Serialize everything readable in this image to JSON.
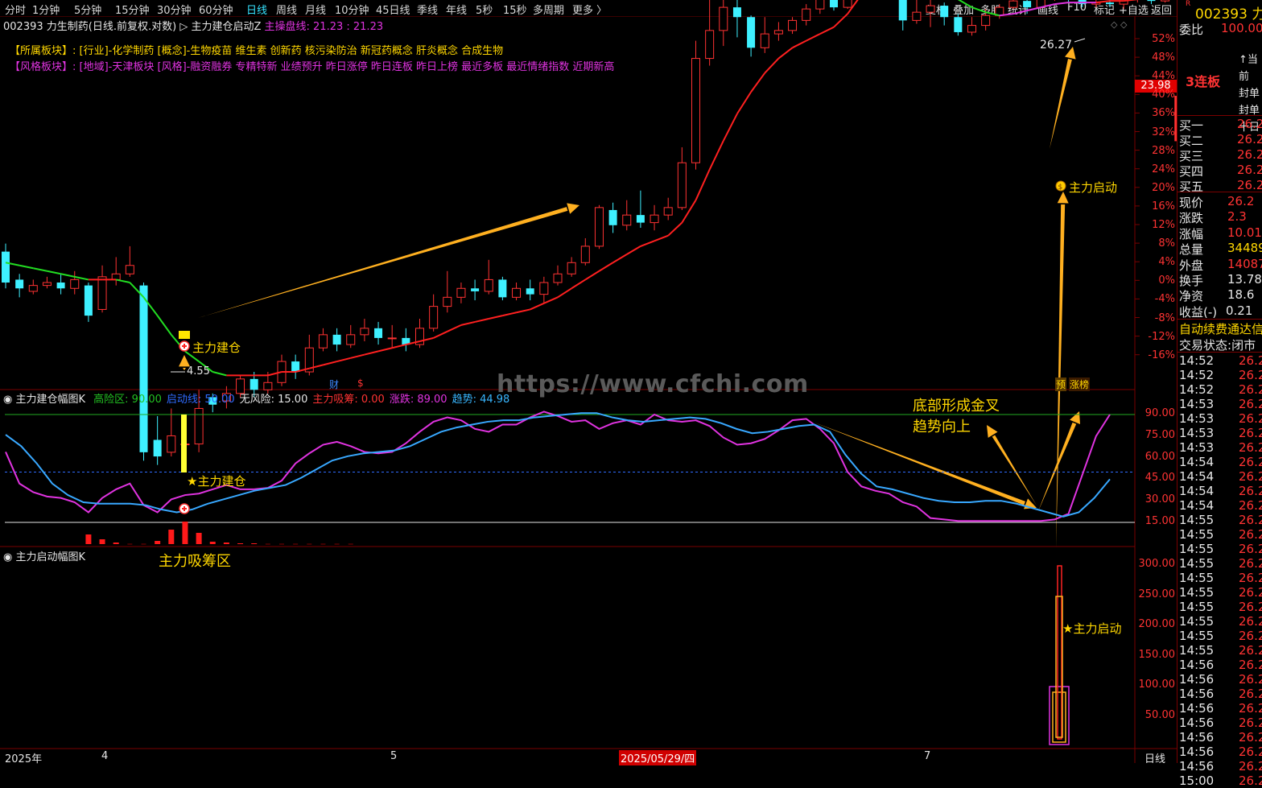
{
  "toolbar": {
    "periods": [
      "分时",
      "1分钟",
      "5分钟",
      "15分钟",
      "30分钟",
      "60分钟",
      "日线",
      "周线",
      "月线",
      "10分钟",
      "45日线",
      "季线",
      "年线",
      "5秒",
      "15秒",
      "多周期",
      "更多 〉"
    ],
    "selected": "日线",
    "right_buttons": [
      "复权",
      "叠加",
      "多股",
      "统计",
      "画线",
      "F10",
      "标记",
      "+自选",
      "返回"
    ]
  },
  "title_line": {
    "stock": "002393 力生制药(日线.前复权.对数)",
    "indicator": "主力建仓启动Z",
    "ma_label": "主操盘线:",
    "ma_value": "21.23 : 21.23"
  },
  "sectors": {
    "belong_label": "【所属板块】:",
    "belong_text": "[行业]-化学制药 [概念]-生物疫苗 维生素 创新药 核污染防治 新冠药概念 肝炎概念 合成生物",
    "style_label": "【风格板块】:",
    "style_text": "[地域]-天津板块 [风格]-融资融券 专精特新 业绩预升 昨日涨停 昨日连板 昨日上榜 最近多板 最近情绪指数 近期新高"
  },
  "price_axis": [
    "52%",
    "48%",
    "44%",
    "40%",
    "36%",
    "32%",
    "28%",
    "24%",
    "20%",
    "16%",
    "12%",
    "8%",
    "4%",
    "0%",
    "-4%",
    "-8%",
    "-12%",
    "-16%"
  ],
  "current_price_tag": "23.98",
  "high_label": "26.27",
  "low_label": "4.55",
  "main_annotations": {
    "build": "主力建仓",
    "launch": "主力启动"
  },
  "watermark": "https://www.cfchi.com",
  "event_markers": {
    "cai": "财",
    "s": "$",
    "yu": "预",
    "zhangbang": "涨榜"
  },
  "panel1": {
    "title": "主力建仓幅图K",
    "items": [
      {
        "text": "高险区: 90.00",
        "color": "#22c022"
      },
      {
        "text": "启动线: 50.00",
        "color": "#2f6bff"
      },
      {
        "text": "无风险: 15.00",
        "color": "#e6e6e6"
      },
      {
        "text": "主力吸筹: 0.00",
        "color": "#ff3333"
      },
      {
        "text": "涨跌: 89.00",
        "color": "#e033e0"
      },
      {
        "text": "趋势: 44.98",
        "color": "#38b6ff"
      }
    ],
    "axis": [
      "90.00",
      "75.00",
      "60.00",
      "45.00",
      "30.00",
      "15.00"
    ],
    "build_label": "★主力建仓",
    "zone_label": "主力吸筹区",
    "cross_label_1": "底部形成金叉",
    "cross_label_2": "趋势向上"
  },
  "panel2": {
    "title": "主力启动幅图K",
    "axis": [
      "300.00",
      "250.00",
      "200.00",
      "150.00",
      "100.00",
      "50.00"
    ],
    "launch_label": "★主力启动"
  },
  "date_axis": {
    "labels": [
      "2025年",
      "4",
      "5",
      "7"
    ],
    "highlight": "2025/05/29/四",
    "period": "日线"
  },
  "right_panel": {
    "code": "002393",
    "code_suffix": "力",
    "weibi_label": "委比",
    "weibi_value": "100.00%",
    "board_label": "3连板",
    "notes": [
      "↑当前",
      "封单",
      "封单",
      "十日"
    ],
    "orders": [
      {
        "label": "买一",
        "value": "26.2"
      },
      {
        "label": "买二",
        "value": "26.2"
      },
      {
        "label": "买三",
        "value": "26.2"
      },
      {
        "label": "买四",
        "value": "26.2"
      },
      {
        "label": "买五",
        "value": "26.2"
      }
    ],
    "stats": [
      {
        "label": "现价",
        "value": "26.2",
        "color": "#ff3333"
      },
      {
        "label": "涨跌",
        "value": "2.3",
        "color": "#ff3333"
      },
      {
        "label": "涨幅",
        "value": "10.01%",
        "color": "#ff3333"
      },
      {
        "label": "总量",
        "value": "34489",
        "color": "#ffd700"
      },
      {
        "label": "外盘",
        "value": "14087",
        "color": "#ff3333"
      },
      {
        "label": "换手",
        "value": "13.78%",
        "color": "#e6e6e6"
      },
      {
        "label": "净资",
        "value": "18.6",
        "color": "#e6e6e6"
      },
      {
        "label": "收益(-)",
        "value": "0.21",
        "color": "#e6e6e6"
      }
    ],
    "auto_fee": "自动续费通达信",
    "trade_state_label": "交易状态:",
    "trade_state_value": "闭市",
    "ticks": [
      "14:52",
      "14:52",
      "14:52",
      "14:53",
      "14:53",
      "14:53",
      "14:53",
      "14:54",
      "14:54",
      "14:54",
      "14:54",
      "14:55",
      "14:55",
      "14:55",
      "14:55",
      "14:55",
      "14:55",
      "14:55",
      "14:55",
      "14:55",
      "14:55",
      "14:56",
      "14:56",
      "14:56",
      "14:56",
      "14:56",
      "14:56",
      "14:56",
      "14:56",
      "15:00"
    ],
    "tick_value": "26.2"
  },
  "chart_data": {
    "type": "candlestick",
    "candles": [
      [
        17.2,
        16.1,
        17.5,
        15.9
      ],
      [
        16.2,
        15.9,
        16.4,
        15.6
      ],
      [
        15.8,
        16.0,
        16.2,
        15.7
      ],
      [
        16.0,
        16.1,
        16.3,
        15.9
      ],
      [
        16.1,
        15.9,
        16.4,
        15.7
      ],
      [
        15.9,
        16.2,
        16.5,
        15.7
      ],
      [
        16.0,
        15.0,
        16.1,
        14.8
      ],
      [
        15.2,
        16.3,
        16.7,
        15.1
      ],
      [
        16.2,
        16.4,
        17.0,
        16.0
      ],
      [
        16.4,
        16.7,
        17.4,
        16.3
      ],
      [
        16.0,
        11.2,
        16.1,
        11.0
      ],
      [
        11.5,
        11.1,
        12.1,
        10.9
      ],
      [
        11.2,
        11.6,
        12.3,
        11.1
      ],
      [
        11.4,
        11.4,
        12.0,
        10.9
      ],
      [
        11.4,
        12.3,
        12.8,
        11.2
      ],
      [
        12.6,
        12.4,
        12.7,
        12.2
      ],
      [
        12.5,
        12.7,
        12.9,
        12.3
      ],
      [
        12.7,
        13.1,
        13.2,
        12.6
      ],
      [
        13.1,
        12.8,
        13.3,
        12.6
      ],
      [
        12.8,
        13.0,
        13.3,
        12.7
      ],
      [
        13.0,
        13.6,
        13.8,
        12.9
      ],
      [
        13.6,
        13.3,
        13.8,
        13.1
      ],
      [
        13.3,
        14.0,
        14.4,
        13.2
      ],
      [
        14.0,
        14.4,
        14.6,
        13.9
      ],
      [
        14.4,
        14.1,
        14.6,
        13.9
      ],
      [
        14.1,
        14.4,
        14.7,
        14.0
      ],
      [
        14.4,
        14.6,
        14.9,
        14.2
      ],
      [
        14.6,
        14.3,
        14.8,
        14.1
      ],
      [
        14.3,
        14.3,
        14.7,
        14.0
      ],
      [
        14.3,
        14.1,
        14.6,
        13.9
      ],
      [
        14.1,
        14.6,
        14.9,
        14.0
      ],
      [
        14.6,
        15.3,
        15.7,
        14.5
      ],
      [
        15.3,
        15.6,
        16.5,
        15.1
      ],
      [
        15.6,
        15.9,
        16.1,
        15.4
      ],
      [
        15.9,
        15.8,
        16.2,
        15.5
      ],
      [
        15.8,
        16.2,
        16.9,
        15.7
      ],
      [
        16.2,
        15.6,
        16.3,
        15.5
      ],
      [
        15.6,
        15.9,
        16.1,
        15.5
      ],
      [
        15.9,
        15.7,
        16.2,
        15.5
      ],
      [
        15.7,
        16.1,
        16.3,
        15.4
      ],
      [
        16.1,
        16.4,
        16.7,
        16.0
      ],
      [
        16.4,
        16.8,
        17.0,
        16.3
      ],
      [
        16.8,
        17.4,
        17.7,
        16.7
      ],
      [
        17.4,
        18.9,
        19.0,
        17.3
      ],
      [
        18.8,
        18.2,
        19.1,
        17.9
      ],
      [
        18.2,
        18.6,
        19.2,
        18.0
      ],
      [
        18.6,
        18.3,
        19.6,
        18.1
      ],
      [
        18.3,
        18.6,
        19.0,
        18.0
      ],
      [
        18.6,
        18.9,
        19.3,
        18.4
      ],
      [
        18.9,
        20.8,
        21.5,
        18.8
      ],
      [
        20.8,
        26.0,
        27.0,
        20.5
      ],
      [
        26.0,
        27.6,
        30.0,
        25.6
      ],
      [
        27.6,
        29.0,
        30.3,
        26.7
      ],
      [
        29.0,
        28.4,
        29.6,
        27.2
      ],
      [
        28.4,
        26.6,
        28.5,
        26.1
      ],
      [
        26.6,
        27.4,
        28.4,
        26.3
      ],
      [
        27.4,
        27.6,
        28.1,
        27.0
      ],
      [
        27.6,
        28.2,
        28.4,
        27.4
      ],
      [
        28.2,
        28.9,
        29.2,
        27.9
      ],
      [
        28.9,
        29.6,
        30.2,
        28.6
      ],
      [
        29.6,
        29.0,
        31.5,
        28.8
      ],
      [
        29.0,
        33.5,
        34.6,
        28.9
      ],
      [
        33.5,
        35.2,
        37.9,
        33.2
      ],
      [
        35.2,
        33.5,
        36.0,
        32.9
      ],
      [
        33.5,
        31.8,
        34.0,
        31.1
      ],
      [
        31.8,
        28.2,
        31.9,
        27.6
      ],
      [
        28.2,
        28.7,
        29.8,
        28.0
      ],
      [
        28.7,
        29.1,
        29.5,
        27.8
      ],
      [
        29.1,
        28.4,
        29.3,
        27.9
      ],
      [
        28.4,
        27.5,
        28.6,
        27.3
      ],
      [
        27.5,
        27.9,
        28.4,
        27.3
      ],
      [
        27.9,
        28.5,
        28.9,
        27.6
      ],
      [
        28.5,
        29.0,
        29.2,
        28.3
      ],
      [
        29.0,
        29.4,
        30.4,
        28.9
      ],
      [
        29.4,
        29.0,
        29.7,
        28.6
      ],
      [
        29.0,
        29.5,
        29.9,
        28.9
      ],
      [
        29.5,
        30.3,
        30.8,
        29.4
      ],
      [
        30.3,
        29.5,
        30.5,
        29.3
      ],
      [
        29.5,
        29.2,
        29.8,
        29.0
      ],
      [
        29.2,
        29.3,
        29.6,
        29.0
      ],
      [
        29.3,
        29.2,
        29.5,
        29.0
      ],
      [
        29.2,
        29.5,
        29.7,
        28.9
      ],
      [
        29.5,
        29.7,
        30.0,
        29.3
      ],
      [
        29.7,
        29.4,
        29.9,
        29.2
      ],
      [
        29.4,
        30.4,
        30.6,
        29.3
      ],
      [
        21.8,
        23.98,
        23.98,
        21.5
      ],
      [
        23.98,
        26.27,
        26.27,
        23.9
      ],
      [
        26.27,
        26.27,
        26.27,
        26.27
      ]
    ],
    "ma": [
      16.8,
      16.7,
      16.6,
      16.5,
      16.4,
      16.3,
      16.2,
      16.2,
      16.2,
      16.1,
      15.6,
      15.0,
      14.4,
      13.9,
      13.6,
      13.3,
      13.2,
      13.2,
      13.2,
      13.2,
      13.3,
      13.3,
      13.4,
      13.5,
      13.6,
      13.7,
      13.8,
      13.9,
      14.0,
      14.1,
      14.2,
      14.3,
      14.5,
      14.7,
      14.8,
      14.9,
      15.0,
      15.1,
      15.2,
      15.4,
      15.6,
      15.9,
      16.2,
      16.5,
      16.8,
      17.1,
      17.4,
      17.6,
      17.8,
      18.3,
      19.2,
      20.5,
      21.8,
      23.1,
      24.2,
      25.2,
      26.0,
      26.6,
      27.0,
      27.4,
      27.8,
      28.6,
      29.8,
      31.2,
      32.5,
      33.0,
      32.4,
      31.3,
      30.3,
      29.5,
      29.0,
      28.7,
      28.5,
      28.6,
      28.8,
      29.0,
      29.2,
      29.3,
      29.3,
      29.3,
      29.4,
      29.4,
      29.5,
      29.6,
      29.9,
      30.5,
      31.7,
      33.5
    ],
    "osc_red": [
      12,
      6,
      2,
      0,
      0,
      4,
      18,
      28,
      14,
      3,
      2,
      1,
      1,
      0,
      0,
      0,
      0,
      0,
      0,
      0
    ],
    "osc_magenta": [
      64,
      42,
      36,
      33,
      32,
      29,
      22,
      32,
      38,
      42,
      27,
      22,
      31,
      34,
      35,
      38,
      41,
      38,
      38,
      39,
      44,
      56,
      63,
      69,
      71,
      68,
      64,
      63,
      64,
      70,
      78,
      85,
      88,
      86,
      80,
      78,
      83,
      83,
      88,
      92,
      89,
      85,
      86,
      80,
      84,
      86,
      83,
      90,
      86,
      85,
      86,
      82,
      74,
      69,
      70,
      73,
      79,
      86,
      87,
      80,
      70,
      50,
      40,
      37,
      35,
      29,
      26,
      18,
      17,
      16,
      16,
      16,
      16,
      16,
      16,
      16,
      17,
      21,
      48,
      75,
      90
    ],
    "osc_blue": [
      76,
      68,
      56,
      42,
      34,
      29,
      28,
      28,
      28,
      27,
      24,
      22,
      24,
      28,
      31,
      34,
      37,
      39,
      41,
      46,
      52,
      58,
      61,
      63,
      64,
      65,
      68,
      73,
      78,
      81,
      83,
      85,
      86,
      86,
      88,
      89,
      90,
      91,
      91,
      88,
      86,
      85,
      86,
      87,
      88,
      87,
      84,
      80,
      77,
      78,
      80,
      82,
      83,
      78,
      62,
      49,
      40,
      38,
      35,
      32,
      30,
      29,
      29,
      30,
      30,
      28,
      25,
      22,
      19,
      22,
      32,
      45
    ]
  }
}
